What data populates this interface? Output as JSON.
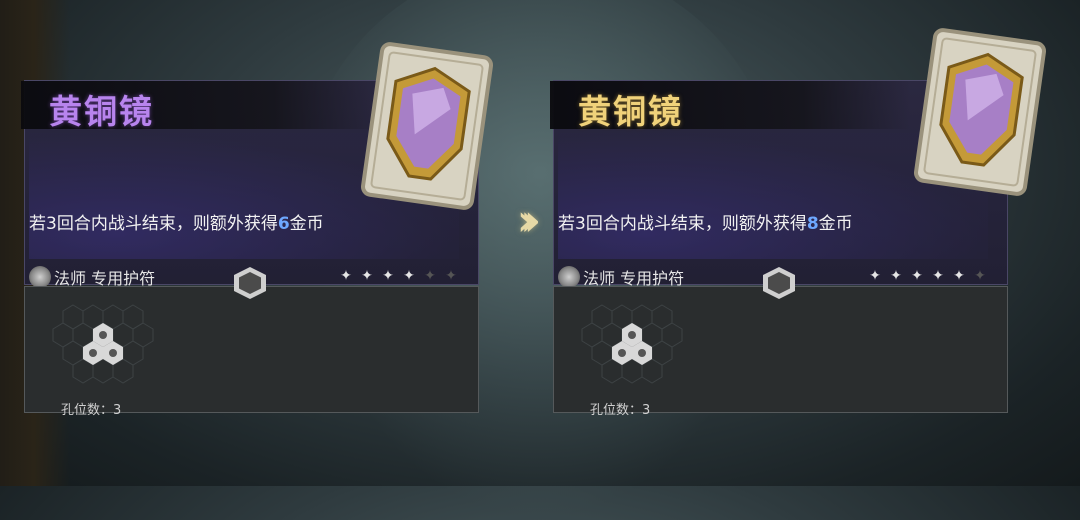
{
  "left_card": {
    "title": "黄铜镜",
    "desc_prefix": "若3回合内战斗结束，则额外获得",
    "desc_value": "6",
    "desc_suffix": "金币",
    "type_label": "法师 专用护符",
    "stars_filled": 4,
    "stars_total": 6,
    "socket_label": "孔位数：3",
    "title_color": "#b884ee"
  },
  "right_card": {
    "title": "黄铜镜",
    "desc_prefix": "若3回合内战斗结束，则额外获得",
    "desc_value": "8",
    "desc_suffix": "金币",
    "type_label": "法师 专用护符",
    "stars_filled": 5,
    "stars_total": 6,
    "socket_label": "孔位数：3",
    "title_color": "#f0d27a"
  },
  "icons": {
    "upgrade_arrow": "chevron-right-triple-icon",
    "type_icon": "mage-emblem-icon",
    "item_icon": "brass-mirror-icon"
  }
}
